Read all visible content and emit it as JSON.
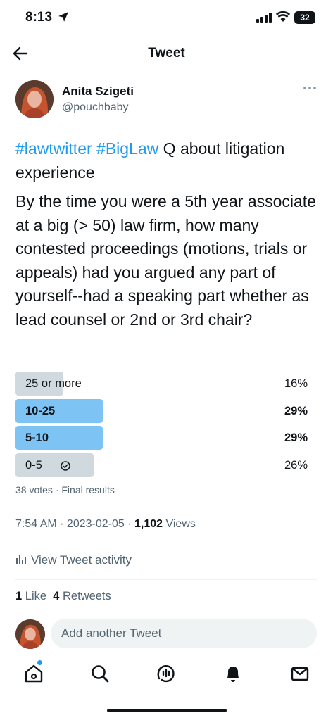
{
  "status_bar": {
    "time": "8:13",
    "battery": "32"
  },
  "header": {
    "title": "Tweet"
  },
  "author": {
    "name": "Anita Szigeti",
    "handle": "@pouchbaby"
  },
  "tweet": {
    "hashtag1": "#lawtwitter",
    "hashtag2": "#BigLaw",
    "line1_rest": " Q about litigation experience",
    "body": "By the time you were a 5th year associate at a big (> 50) law firm, how many contested proceedings (motions, trials or appeals) had you argued any part of yourself--had a speaking part whether as lead counsel or 2nd or 3rd chair?"
  },
  "poll": {
    "options": [
      {
        "label": "25 or more",
        "pct": "16%",
        "value": 0.16,
        "winner": false,
        "selected": false
      },
      {
        "label": "10-25",
        "pct": "29%",
        "value": 0.29,
        "winner": true,
        "selected": false
      },
      {
        "label": "5-10",
        "pct": "29%",
        "value": 0.29,
        "winner": true,
        "selected": false
      },
      {
        "label": "0-5",
        "pct": "26%",
        "value": 0.26,
        "winner": false,
        "selected": true
      }
    ],
    "meta": "38 votes · Final results",
    "colors": {
      "winner": "#7dc4f5",
      "other": "#cfd9de"
    }
  },
  "meta": {
    "time_date": "7:54 AM · 2023-02-05 · ",
    "views_count": "1,102",
    "views_label": " Views"
  },
  "activity": {
    "label": "View Tweet activity"
  },
  "engagement": {
    "likes_count": "1",
    "likes_label": " Like",
    "retweets_count": "4",
    "retweets_label": " Retweets"
  },
  "reply": {
    "placeholder": "Add another Tweet"
  },
  "tabs": [
    "home-icon",
    "search-icon",
    "spaces-icon",
    "notifications-icon",
    "messages-icon"
  ]
}
